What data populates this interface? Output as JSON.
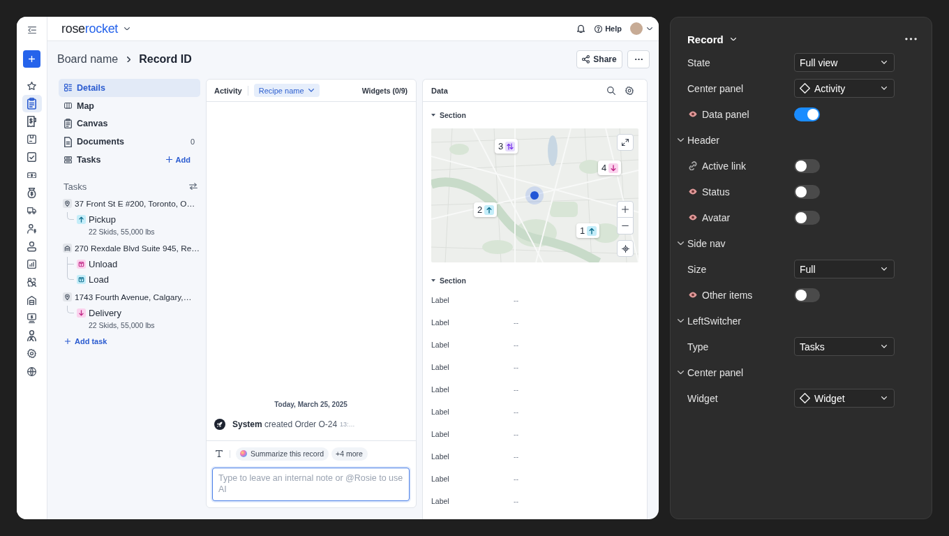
{
  "top_bar": {
    "logo": {
      "first": "rose",
      "second": "rocket"
    },
    "help": "Help"
  },
  "nav_rail": [
    {
      "selected": false
    },
    {
      "selected": true
    },
    {
      "selected": false
    },
    {
      "selected": false
    },
    {
      "selected": false
    },
    {
      "selected": false
    },
    {
      "selected": false
    },
    {
      "selected": false
    },
    {
      "selected": false
    },
    {
      "selected": false
    },
    {
      "selected": false
    },
    {
      "selected": false
    },
    {
      "selected": false
    },
    {
      "selected": false
    },
    {
      "selected": false
    },
    {
      "selected": false
    },
    {
      "selected": false
    }
  ],
  "breadcrumb": {
    "board": "Board name",
    "record": "Record ID"
  },
  "header_actions": {
    "share": "Share"
  },
  "record_nav": [
    {
      "label": "Details",
      "selected": true
    },
    {
      "label": "Map",
      "selected": false
    },
    {
      "label": "Canvas",
      "selected": false
    },
    {
      "label": "Documents",
      "selected": false,
      "count": "0"
    },
    {
      "label": "Tasks",
      "selected": false,
      "action": "Add"
    }
  ],
  "tasks": {
    "title": "Tasks",
    "stops": [
      {
        "kind": "location",
        "address": "37 Front St E #200, Toronto, O…",
        "children": [
          {
            "kind": "pickup",
            "label": "Pickup",
            "detail": "22 Skids, 55,000 lbs"
          }
        ]
      },
      {
        "kind": "warehouse",
        "address": "270 Rexdale Blvd Suite 945, Re…",
        "children": [
          {
            "kind": "unload",
            "label": "Unload"
          },
          {
            "kind": "load",
            "label": "Load"
          }
        ]
      },
      {
        "kind": "location",
        "address": "1743 Fourth Avenue, Calgary,…",
        "children": [
          {
            "kind": "delivery",
            "label": "Delivery",
            "detail": "22 Skids, 55,000 lbs"
          }
        ]
      }
    ],
    "add_task": "Add task"
  },
  "activity": {
    "tab": "Activity",
    "recipe": "Recipe name",
    "widgets": "Widgets (0/9)",
    "date": "Today, March 25, 2025",
    "events": [
      {
        "text": "**System** created Order O-24",
        "time": "13:…"
      }
    ],
    "composer": {
      "suggestions": [
        "Summarize this record"
      ],
      "more": "+4 more",
      "placeholder": "Type to leave an internal note or @Rosie to use AI"
    }
  },
  "data_panel": {
    "title": "Data",
    "sections": [
      {
        "kind": "map",
        "title": "Section",
        "expanded": true,
        "markers": [
          {
            "number": "3",
            "kind": "pickup-delivery"
          },
          {
            "number": "4",
            "kind": "delivery"
          },
          {
            "number": "2",
            "kind": "pickup"
          },
          {
            "number": "1",
            "kind": "pickup"
          }
        ]
      },
      {
        "kind": "fields",
        "title": "Section",
        "expanded": true,
        "fields": [
          {
            "label": "Label",
            "value": "--"
          },
          {
            "label": "Label",
            "value": "--"
          },
          {
            "label": "Label",
            "value": "--"
          },
          {
            "label": "Label",
            "value": "--"
          },
          {
            "label": "Label",
            "value": "--"
          },
          {
            "label": "Label",
            "value": "--"
          },
          {
            "label": "Label",
            "value": "--"
          },
          {
            "label": "Label",
            "value": "--"
          },
          {
            "label": "Label",
            "value": "--"
          },
          {
            "label": "Label",
            "value": "--"
          }
        ]
      }
    ]
  },
  "settings_panel": {
    "title": "Record",
    "rows": [
      {
        "kind": "select",
        "label": "State",
        "value": "Full view"
      },
      {
        "kind": "component-select",
        "label": "Center panel",
        "value": "Activity"
      },
      {
        "kind": "eye-toggle",
        "label": "Data panel",
        "on": true
      },
      {
        "kind": "section",
        "label": "Header",
        "expanded": true,
        "children": [
          {
            "kind": "link-toggle",
            "label": "Active link",
            "on": false
          },
          {
            "kind": "eye-toggle",
            "label": "Status",
            "on": false
          },
          {
            "kind": "eye-toggle",
            "label": "Avatar",
            "on": false
          }
        ]
      },
      {
        "kind": "section",
        "label": "Side nav",
        "expanded": true,
        "children": [
          {
            "kind": "select",
            "label": "Size",
            "value": "Full"
          },
          {
            "kind": "eye-toggle",
            "label": "Other items",
            "on": false
          }
        ]
      },
      {
        "kind": "section",
        "label": "LeftSwitcher",
        "expanded": true,
        "children": [
          {
            "kind": "select",
            "label": "Type",
            "value": "Tasks"
          }
        ]
      },
      {
        "kind": "section",
        "label": "Center panel",
        "expanded": true,
        "children": [
          {
            "kind": "component-select",
            "label": "Widget",
            "value": "Widget"
          }
        ]
      }
    ]
  }
}
